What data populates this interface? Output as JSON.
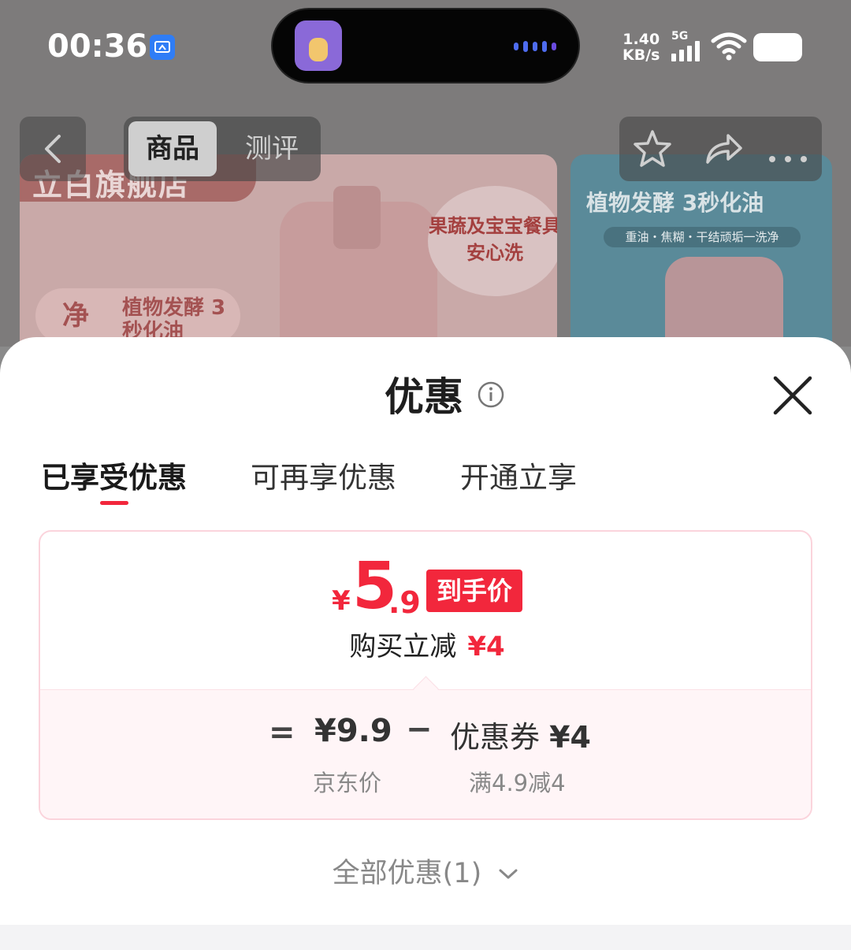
{
  "status_bar": {
    "time": "00:36",
    "net_speed_value": "1.40",
    "net_speed_unit": "KB/s",
    "signal_label": "5G",
    "icons": [
      "screen-cast-icon",
      "signal-icon",
      "wifi-icon",
      "battery-icon"
    ]
  },
  "background": {
    "store_banner": "立白旗舰店",
    "card1_badge": "果蔬及宝宝餐具 安心洗",
    "card1_pill": "植物发酵 3秒化油",
    "card1_pill_icon_text": "净",
    "card2_title": "植物发酵 3秒化油",
    "card2_sub": "重油・焦糊・干结顽垢一洗净"
  },
  "nav": {
    "tab_goods": "商品",
    "tab_review": "测评",
    "icons": [
      "back-icon",
      "star-icon",
      "share-icon",
      "more-icon"
    ]
  },
  "sheet": {
    "title": "优惠",
    "tabs": [
      {
        "label": "已享受优惠",
        "active": true
      },
      {
        "label": "可再享优惠",
        "active": false
      },
      {
        "label": "开通立享",
        "active": false
      }
    ],
    "price": {
      "currency": "¥",
      "integer": "5",
      "decimal": ".9",
      "badge": "到手价"
    },
    "reduce_text": "购买立减",
    "reduce_amount": "¥4",
    "breakdown": {
      "equals": "=",
      "jd_price": "¥9.9",
      "minus": "−",
      "coupon_label": "优惠券",
      "coupon_amount": "¥4",
      "jd_price_caption": "京东价",
      "coupon_caption": "满4.9减4"
    },
    "all_offers": "全部优惠(1)"
  },
  "colors": {
    "accent_red": "#f2273c",
    "card_border": "#fbd4dc",
    "card_tint": "#fff5f7"
  }
}
